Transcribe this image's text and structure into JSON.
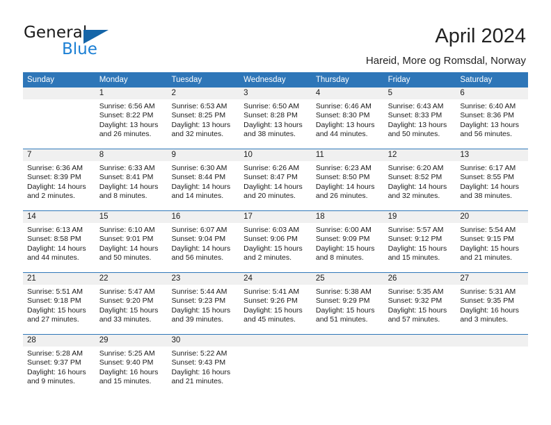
{
  "logo": {
    "word_one": "General",
    "word_two": "Blue",
    "triangle_color": "#1565a8",
    "blue_color": "#1b7fd4"
  },
  "header": {
    "title": "April 2024",
    "subtitle": "Hareid, More og Romsdal, Norway"
  },
  "theme": {
    "header_band": "#2e76b8",
    "date_band": "#f0f0f0",
    "week_rule": "#2e76b8"
  },
  "weekdays": [
    "Sunday",
    "Monday",
    "Tuesday",
    "Wednesday",
    "Thursday",
    "Friday",
    "Saturday"
  ],
  "weeks": [
    [
      {
        "day": "",
        "sunrise": "",
        "sunset": "",
        "daylight1": "",
        "daylight2": "",
        "empty": true
      },
      {
        "day": "1",
        "sunrise": "Sunrise: 6:56 AM",
        "sunset": "Sunset: 8:22 PM",
        "daylight1": "Daylight: 13 hours",
        "daylight2": "and 26 minutes."
      },
      {
        "day": "2",
        "sunrise": "Sunrise: 6:53 AM",
        "sunset": "Sunset: 8:25 PM",
        "daylight1": "Daylight: 13 hours",
        "daylight2": "and 32 minutes."
      },
      {
        "day": "3",
        "sunrise": "Sunrise: 6:50 AM",
        "sunset": "Sunset: 8:28 PM",
        "daylight1": "Daylight: 13 hours",
        "daylight2": "and 38 minutes."
      },
      {
        "day": "4",
        "sunrise": "Sunrise: 6:46 AM",
        "sunset": "Sunset: 8:30 PM",
        "daylight1": "Daylight: 13 hours",
        "daylight2": "and 44 minutes."
      },
      {
        "day": "5",
        "sunrise": "Sunrise: 6:43 AM",
        "sunset": "Sunset: 8:33 PM",
        "daylight1": "Daylight: 13 hours",
        "daylight2": "and 50 minutes."
      },
      {
        "day": "6",
        "sunrise": "Sunrise: 6:40 AM",
        "sunset": "Sunset: 8:36 PM",
        "daylight1": "Daylight: 13 hours",
        "daylight2": "and 56 minutes."
      }
    ],
    [
      {
        "day": "7",
        "sunrise": "Sunrise: 6:36 AM",
        "sunset": "Sunset: 8:39 PM",
        "daylight1": "Daylight: 14 hours",
        "daylight2": "and 2 minutes."
      },
      {
        "day": "8",
        "sunrise": "Sunrise: 6:33 AM",
        "sunset": "Sunset: 8:41 PM",
        "daylight1": "Daylight: 14 hours",
        "daylight2": "and 8 minutes."
      },
      {
        "day": "9",
        "sunrise": "Sunrise: 6:30 AM",
        "sunset": "Sunset: 8:44 PM",
        "daylight1": "Daylight: 14 hours",
        "daylight2": "and 14 minutes."
      },
      {
        "day": "10",
        "sunrise": "Sunrise: 6:26 AM",
        "sunset": "Sunset: 8:47 PM",
        "daylight1": "Daylight: 14 hours",
        "daylight2": "and 20 minutes."
      },
      {
        "day": "11",
        "sunrise": "Sunrise: 6:23 AM",
        "sunset": "Sunset: 8:50 PM",
        "daylight1": "Daylight: 14 hours",
        "daylight2": "and 26 minutes."
      },
      {
        "day": "12",
        "sunrise": "Sunrise: 6:20 AM",
        "sunset": "Sunset: 8:52 PM",
        "daylight1": "Daylight: 14 hours",
        "daylight2": "and 32 minutes."
      },
      {
        "day": "13",
        "sunrise": "Sunrise: 6:17 AM",
        "sunset": "Sunset: 8:55 PM",
        "daylight1": "Daylight: 14 hours",
        "daylight2": "and 38 minutes."
      }
    ],
    [
      {
        "day": "14",
        "sunrise": "Sunrise: 6:13 AM",
        "sunset": "Sunset: 8:58 PM",
        "daylight1": "Daylight: 14 hours",
        "daylight2": "and 44 minutes."
      },
      {
        "day": "15",
        "sunrise": "Sunrise: 6:10 AM",
        "sunset": "Sunset: 9:01 PM",
        "daylight1": "Daylight: 14 hours",
        "daylight2": "and 50 minutes."
      },
      {
        "day": "16",
        "sunrise": "Sunrise: 6:07 AM",
        "sunset": "Sunset: 9:04 PM",
        "daylight1": "Daylight: 14 hours",
        "daylight2": "and 56 minutes."
      },
      {
        "day": "17",
        "sunrise": "Sunrise: 6:03 AM",
        "sunset": "Sunset: 9:06 PM",
        "daylight1": "Daylight: 15 hours",
        "daylight2": "and 2 minutes."
      },
      {
        "day": "18",
        "sunrise": "Sunrise: 6:00 AM",
        "sunset": "Sunset: 9:09 PM",
        "daylight1": "Daylight: 15 hours",
        "daylight2": "and 8 minutes."
      },
      {
        "day": "19",
        "sunrise": "Sunrise: 5:57 AM",
        "sunset": "Sunset: 9:12 PM",
        "daylight1": "Daylight: 15 hours",
        "daylight2": "and 15 minutes."
      },
      {
        "day": "20",
        "sunrise": "Sunrise: 5:54 AM",
        "sunset": "Sunset: 9:15 PM",
        "daylight1": "Daylight: 15 hours",
        "daylight2": "and 21 minutes."
      }
    ],
    [
      {
        "day": "21",
        "sunrise": "Sunrise: 5:51 AM",
        "sunset": "Sunset: 9:18 PM",
        "daylight1": "Daylight: 15 hours",
        "daylight2": "and 27 minutes."
      },
      {
        "day": "22",
        "sunrise": "Sunrise: 5:47 AM",
        "sunset": "Sunset: 9:20 PM",
        "daylight1": "Daylight: 15 hours",
        "daylight2": "and 33 minutes."
      },
      {
        "day": "23",
        "sunrise": "Sunrise: 5:44 AM",
        "sunset": "Sunset: 9:23 PM",
        "daylight1": "Daylight: 15 hours",
        "daylight2": "and 39 minutes."
      },
      {
        "day": "24",
        "sunrise": "Sunrise: 5:41 AM",
        "sunset": "Sunset: 9:26 PM",
        "daylight1": "Daylight: 15 hours",
        "daylight2": "and 45 minutes."
      },
      {
        "day": "25",
        "sunrise": "Sunrise: 5:38 AM",
        "sunset": "Sunset: 9:29 PM",
        "daylight1": "Daylight: 15 hours",
        "daylight2": "and 51 minutes."
      },
      {
        "day": "26",
        "sunrise": "Sunrise: 5:35 AM",
        "sunset": "Sunset: 9:32 PM",
        "daylight1": "Daylight: 15 hours",
        "daylight2": "and 57 minutes."
      },
      {
        "day": "27",
        "sunrise": "Sunrise: 5:31 AM",
        "sunset": "Sunset: 9:35 PM",
        "daylight1": "Daylight: 16 hours",
        "daylight2": "and 3 minutes."
      }
    ],
    [
      {
        "day": "28",
        "sunrise": "Sunrise: 5:28 AM",
        "sunset": "Sunset: 9:37 PM",
        "daylight1": "Daylight: 16 hours",
        "daylight2": "and 9 minutes."
      },
      {
        "day": "29",
        "sunrise": "Sunrise: 5:25 AM",
        "sunset": "Sunset: 9:40 PM",
        "daylight1": "Daylight: 16 hours",
        "daylight2": "and 15 minutes."
      },
      {
        "day": "30",
        "sunrise": "Sunrise: 5:22 AM",
        "sunset": "Sunset: 9:43 PM",
        "daylight1": "Daylight: 16 hours",
        "daylight2": "and 21 minutes."
      },
      {
        "day": "",
        "sunrise": "",
        "sunset": "",
        "daylight1": "",
        "daylight2": "",
        "empty": true
      },
      {
        "day": "",
        "sunrise": "",
        "sunset": "",
        "daylight1": "",
        "daylight2": "",
        "empty": true
      },
      {
        "day": "",
        "sunrise": "",
        "sunset": "",
        "daylight1": "",
        "daylight2": "",
        "empty": true
      },
      {
        "day": "",
        "sunrise": "",
        "sunset": "",
        "daylight1": "",
        "daylight2": "",
        "empty": true
      }
    ]
  ]
}
